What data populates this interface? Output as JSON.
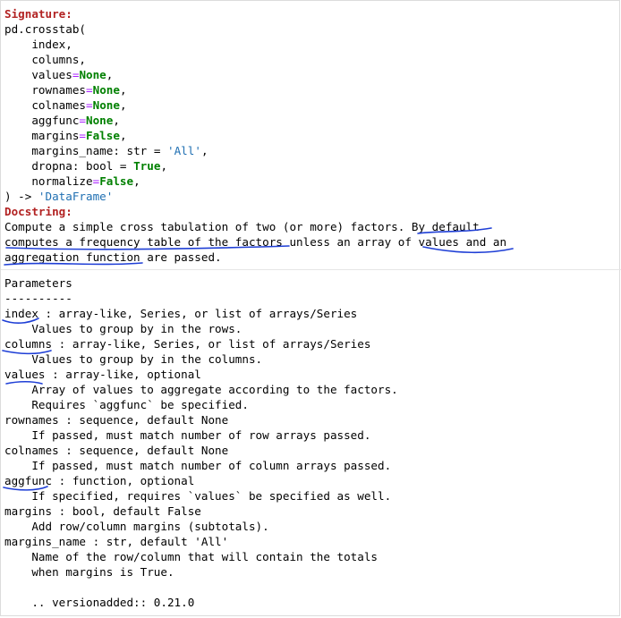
{
  "signature": {
    "header": "Signature:",
    "call": "pd.crosstab(",
    "params": [
      {
        "name": "index",
        "sep": ",",
        "default": "",
        "annot": "",
        "str": "",
        "tail": ""
      },
      {
        "name": "columns",
        "sep": ",",
        "default": "",
        "annot": "",
        "str": "",
        "tail": ""
      },
      {
        "name": "values",
        "sep": "=",
        "default": "None",
        "annot": "",
        "str": "",
        "tail": ","
      },
      {
        "name": "rownames",
        "sep": "=",
        "default": "None",
        "annot": "",
        "str": "",
        "tail": ","
      },
      {
        "name": "colnames",
        "sep": "=",
        "default": "None",
        "annot": "",
        "str": "",
        "tail": ","
      },
      {
        "name": "aggfunc",
        "sep": "=",
        "default": "None",
        "annot": "",
        "str": "",
        "tail": ","
      },
      {
        "name": "margins",
        "sep": "=",
        "default": "False",
        "annot": "",
        "str": "",
        "tail": ","
      },
      {
        "name": "margins_name",
        "sep": ": str = ",
        "default": "",
        "annot": "",
        "str": "'All'",
        "tail": ","
      },
      {
        "name": "dropna",
        "sep": ": bool = ",
        "default": "True",
        "annot": "",
        "str": "",
        "tail": ","
      },
      {
        "name": "normalize",
        "sep": "=",
        "default": "False",
        "annot": "",
        "str": "",
        "tail": ","
      }
    ],
    "closing_paren": ") -> ",
    "return_type": "'DataFrame'"
  },
  "docstring": {
    "header": "Docstring:",
    "lines": [
      "Compute a simple cross tabulation of two (or more) factors. By default",
      "computes a frequency table of the factors unless an array of values and an",
      "aggregation function are passed."
    ]
  },
  "parameters_section": {
    "lines": [
      "Parameters",
      "----------",
      "index : array-like, Series, or list of arrays/Series",
      "    Values to group by in the rows.",
      "columns : array-like, Series, or list of arrays/Series",
      "    Values to group by in the columns.",
      "values : array-like, optional",
      "    Array of values to aggregate according to the factors.",
      "    Requires `aggfunc` be specified.",
      "rownames : sequence, default None",
      "    If passed, must match number of row arrays passed.",
      "colnames : sequence, default None",
      "    If passed, must match number of column arrays passed.",
      "aggfunc : function, optional",
      "    If specified, requires `values` be specified as well.",
      "margins : bool, default False",
      "    Add row/column margins (subtotals).",
      "margins_name : str, default 'All'",
      "    Name of the row/column that will contain the totals",
      "    when margins is True.",
      "",
      "    .. versionadded:: 0.21.0"
    ]
  },
  "colors": {
    "header": "#b22222",
    "keyword": "#008000",
    "string": "#1f6fb2",
    "annotation_pen": "#1f3fd6"
  }
}
